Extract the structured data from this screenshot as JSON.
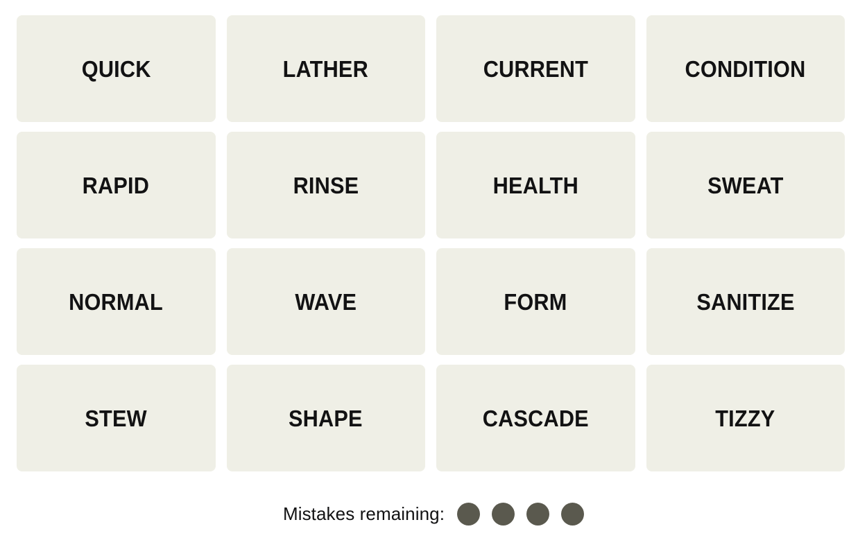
{
  "game": {
    "name": "Connections",
    "tile_bg_color": "#EFEFE6",
    "tile_text_color": "#121213",
    "page_bg_color": "#FFFFFF",
    "mistake_dot_color": "#5A594E"
  },
  "grid": {
    "rows": 4,
    "columns": 4,
    "tiles": [
      {
        "label": "QUICK",
        "row": 1,
        "col": 1,
        "selected": false
      },
      {
        "label": "LATHER",
        "row": 1,
        "col": 2,
        "selected": false
      },
      {
        "label": "CURRENT",
        "row": 1,
        "col": 3,
        "selected": false
      },
      {
        "label": "CONDITION",
        "row": 1,
        "col": 4,
        "selected": false
      },
      {
        "label": "RAPID",
        "row": 2,
        "col": 1,
        "selected": false
      },
      {
        "label": "RINSE",
        "row": 2,
        "col": 2,
        "selected": false
      },
      {
        "label": "HEALTH",
        "row": 2,
        "col": 3,
        "selected": false
      },
      {
        "label": "SWEAT",
        "row": 2,
        "col": 4,
        "selected": false
      },
      {
        "label": "NORMAL",
        "row": 3,
        "col": 1,
        "selected": false
      },
      {
        "label": "WAVE",
        "row": 3,
        "col": 2,
        "selected": false
      },
      {
        "label": "FORM",
        "row": 3,
        "col": 3,
        "selected": false
      },
      {
        "label": "SANITIZE",
        "row": 3,
        "col": 4,
        "selected": false
      },
      {
        "label": "STEW",
        "row": 4,
        "col": 1,
        "selected": false
      },
      {
        "label": "SHAPE",
        "row": 4,
        "col": 2,
        "selected": false
      },
      {
        "label": "CASCADE",
        "row": 4,
        "col": 3,
        "selected": false
      },
      {
        "label": "TIZZY",
        "row": 4,
        "col": 4,
        "selected": false
      }
    ]
  },
  "mistakes": {
    "label": "Mistakes remaining:",
    "remaining": 4,
    "total": 4,
    "dots": [
      "filled",
      "filled",
      "filled",
      "filled"
    ]
  }
}
